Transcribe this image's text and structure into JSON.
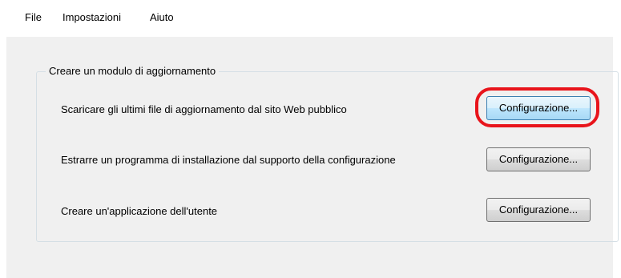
{
  "menu": {
    "file": "File",
    "settings": "Impostazioni",
    "help": "Aiuto"
  },
  "group": {
    "title": "Creare un modulo di aggiornamento",
    "rows": [
      {
        "label": "Scaricare gli ultimi file di aggiornamento dal sito Web pubblico",
        "button": "Configurazione...",
        "highlighted": true
      },
      {
        "label": "Estrarre un programma di installazione dal supporto della configurazione",
        "button": "Configurazione...",
        "highlighted": false
      },
      {
        "label": "Creare un'applicazione dell'utente",
        "button": "Configurazione...",
        "highlighted": false
      }
    ]
  },
  "colors": {
    "highlight_ring": "#e8141b",
    "window_background": "#f0f0f0"
  }
}
